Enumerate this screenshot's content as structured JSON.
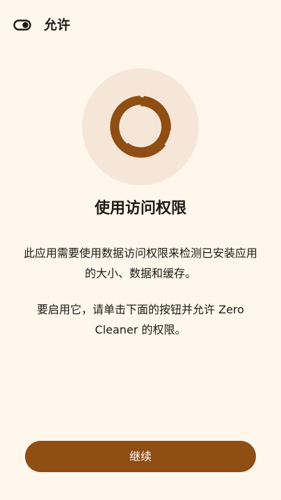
{
  "header": {
    "icon": "toggle-icon",
    "title": "允许"
  },
  "hero": {
    "icon": "donut-progress-icon",
    "colors": {
      "circle_bg": "#F5E6D8",
      "ring": "#8E4E14"
    }
  },
  "content": {
    "title": "使用访问权限",
    "paragraph_1": "此应用需要使用数据访问权限来检测已安装应用的大小、数据和缓存。",
    "paragraph_2": "要启用它，请单击下面的按钮并允许 Zero Cleaner 的权限。"
  },
  "actions": {
    "continue_label": "继续"
  },
  "colors": {
    "background": "#FFF6EC",
    "accent": "#8E4E14",
    "text": "#1F1A15"
  }
}
